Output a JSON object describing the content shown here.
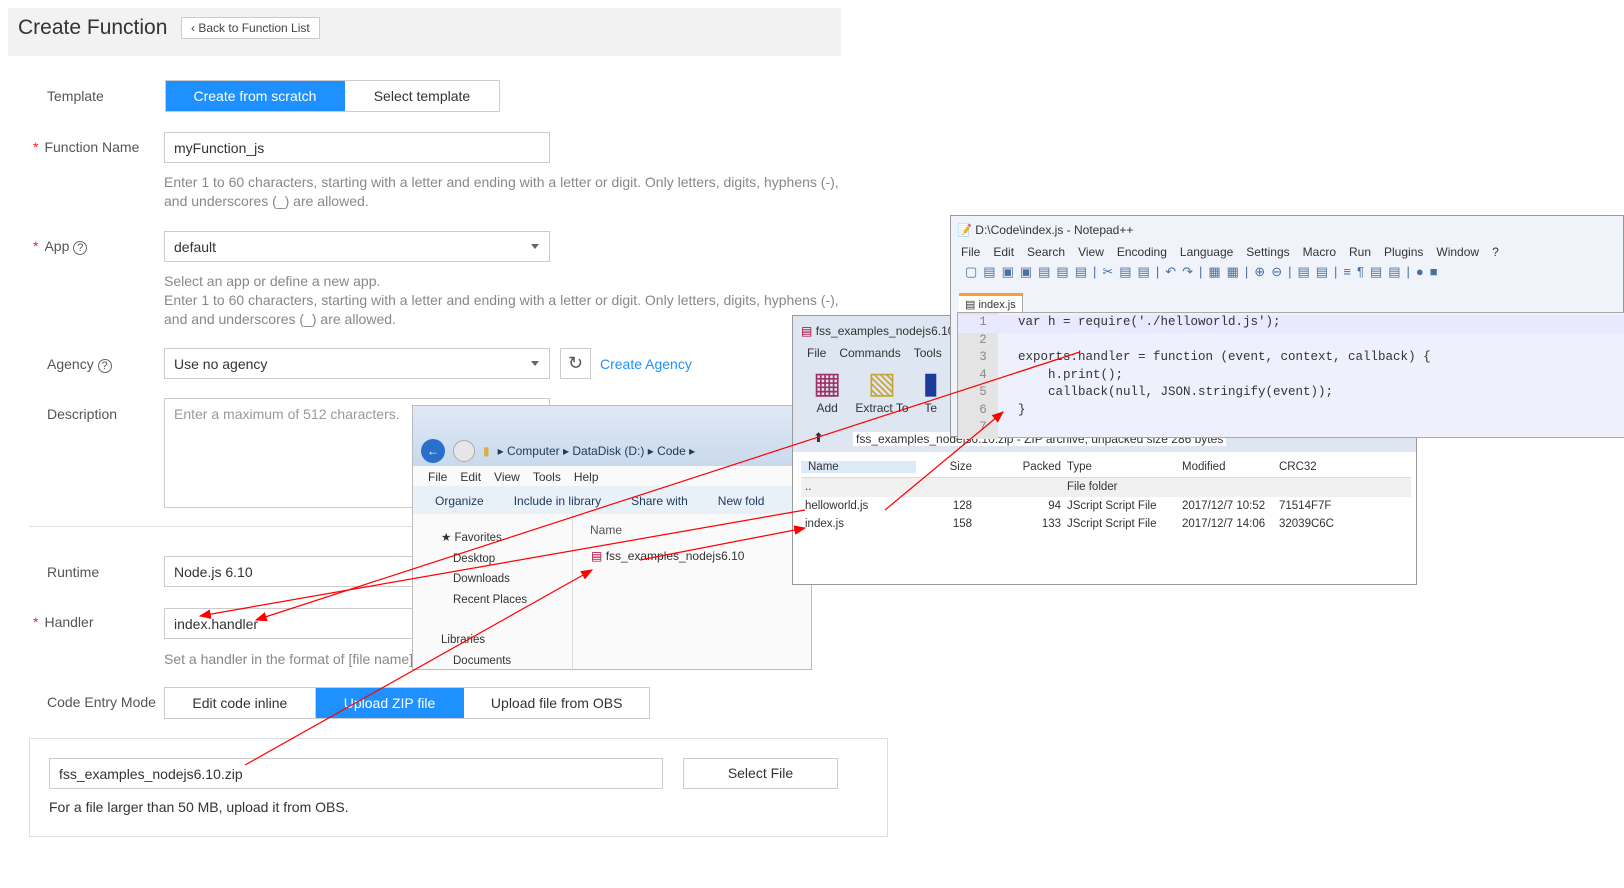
{
  "header": {
    "title": "Create Function",
    "back": "Back to Function List"
  },
  "form": {
    "template": {
      "label": "Template",
      "options": [
        "Create from scratch",
        "Select template"
      ]
    },
    "function_name": {
      "label": "Function Name",
      "value": "myFunction_js",
      "hint": "Enter 1 to 60 characters, starting with a letter and ending with a letter or digit. Only letters, digits, hyphens (-), and underscores (_) are allowed."
    },
    "app": {
      "label": "App",
      "value": "default",
      "hint1": "Select an app or define a new app.",
      "hint2": "Enter 1 to 60 characters, starting with a letter and ending with a letter or digit. Only letters, digits, hyphens (-), and and underscores (_) are allowed."
    },
    "agency": {
      "label": "Agency",
      "value": "Use no agency",
      "create": "Create Agency"
    },
    "description": {
      "label": "Description",
      "placeholder": "Enter a maximum of 512 characters."
    },
    "runtime": {
      "label": "Runtime",
      "value": "Node.js 6.10"
    },
    "handler": {
      "label": "Handler",
      "value": "index.handler",
      "hint": "Set a handler in the format of [file name]."
    },
    "code_entry": {
      "label": "Code Entry Mode",
      "options": [
        "Edit code inline",
        "Upload ZIP file",
        "Upload file from OBS"
      ]
    },
    "upload": {
      "file": "fss_examples_nodejs6.10.zip",
      "select": "Select File",
      "hint": "For a file larger than 50 MB, upload it from OBS."
    }
  },
  "explorer": {
    "breadcrumb": [
      "Computer",
      "DataDisk (D:)",
      "Code"
    ],
    "menu": [
      "File",
      "Edit",
      "View",
      "Tools",
      "Help"
    ],
    "toolbar": [
      "Organize",
      "Include in library",
      "Share with",
      "New fold"
    ],
    "nav": [
      "Favorites",
      "Desktop",
      "Downloads",
      "Recent Places",
      "Libraries",
      "Documents"
    ],
    "col": "Name",
    "file": "fss_examples_nodejs6.10"
  },
  "winrar": {
    "title": "fss_examples_nodejs6.10.",
    "menu": [
      "File",
      "Commands",
      "Tools"
    ],
    "tools": [
      "Add",
      "Extract To",
      "Te"
    ],
    "path": "fss_examples_nodejs6.10.zip - ZIP archive, unpacked size 286 bytes",
    "columns": [
      "Name",
      "Size",
      "Packed",
      "Type",
      "Modified",
      "CRC32"
    ],
    "rows": [
      [
        "..",
        "",
        "",
        "File folder",
        "",
        ""
      ],
      [
        "helloworld.js",
        "128",
        "94",
        "JScript Script File",
        "2017/12/7 10:52",
        "71514F7F"
      ],
      [
        "index.js",
        "158",
        "133",
        "JScript Script File",
        "2017/12/7 14:06",
        "32039C6C"
      ]
    ]
  },
  "notepad": {
    "title": "D:\\Code\\index.js - Notepad++",
    "menu": [
      "File",
      "Edit",
      "Search",
      "View",
      "Encoding",
      "Language",
      "Settings",
      "Macro",
      "Run",
      "Plugins",
      "Window",
      "?"
    ],
    "tab": "index.js",
    "lines": [
      "var h = require('./helloworld.js');",
      "",
      "exports.handler = function (event, context, callback) {",
      "    h.print();",
      "    callback(null, JSON.stringify(event));",
      "}",
      ""
    ]
  },
  "colors": {
    "accent": "#1e90ff",
    "arrow": "#ff0000"
  }
}
